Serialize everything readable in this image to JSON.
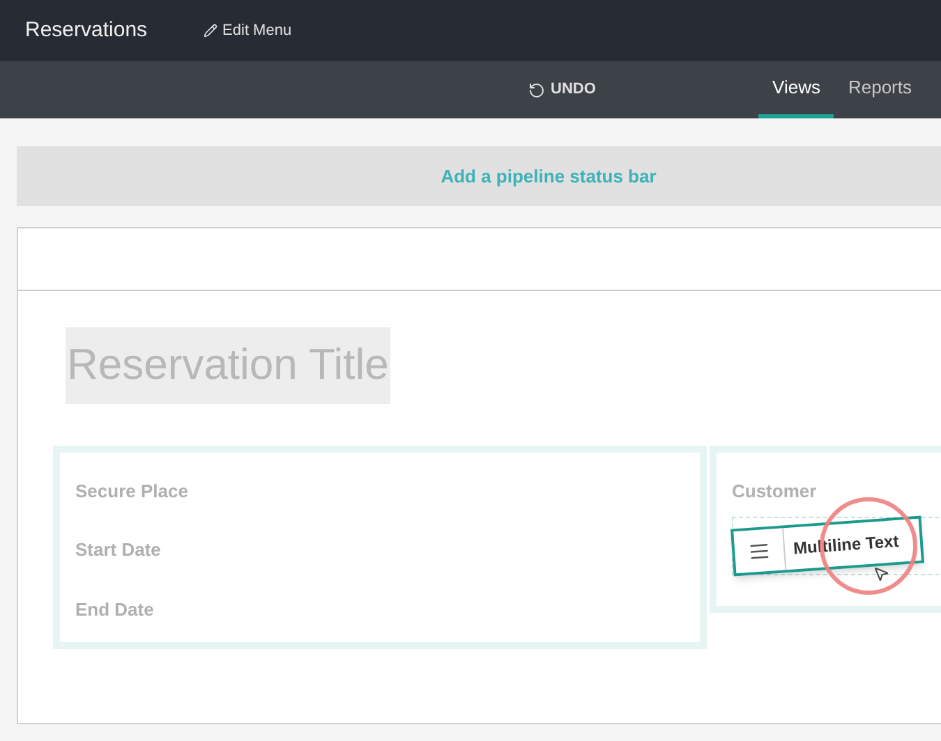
{
  "app_title": "Reservations",
  "edit_menu": "Edit Menu",
  "undo": "UNDO",
  "tabs": [
    {
      "label": "Views",
      "selected": true
    },
    {
      "label": "Reports",
      "selected": false
    }
  ],
  "pipeline_bar": "Add a pipeline status bar",
  "form": {
    "title_placeholder": "Reservation Title",
    "left_fields": [
      "Secure Place",
      "Start Date",
      "End Date"
    ],
    "right_fields": [
      "Customer"
    ]
  },
  "dragged_field": {
    "label": "Multiline Text"
  }
}
